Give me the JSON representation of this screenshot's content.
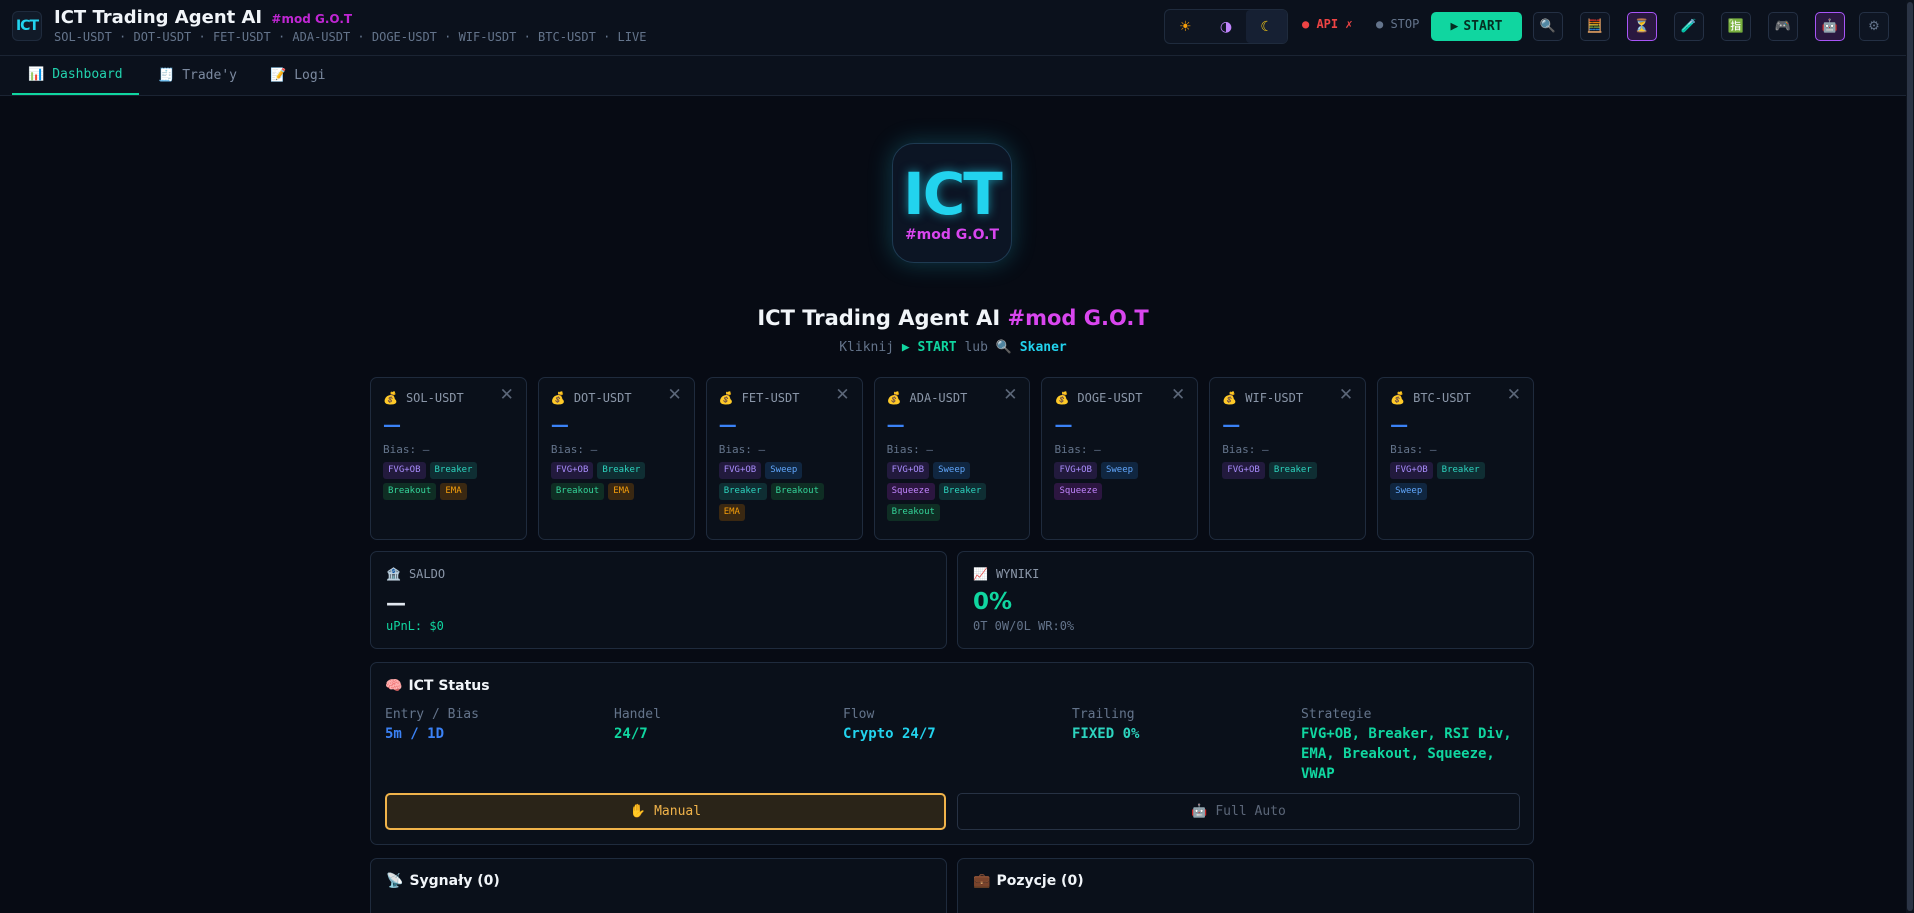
{
  "app": {
    "logo_text": "ICT",
    "title": "ICT Trading Agent AI",
    "title_tag": "#mod G.O.T",
    "ticker_line": "SOL-USDT · DOT-USDT · FET-USDT · ADA-USDT · DOGE-USDT · WIF-USDT · BTC-USDT · LIVE"
  },
  "toolbar": {
    "themes": [
      {
        "name": "light",
        "icon": "☀"
      },
      {
        "name": "contrast",
        "icon": "◑"
      },
      {
        "name": "dark",
        "icon": "☾"
      }
    ],
    "api_status": "● API ✗",
    "stop_status": "● STOP",
    "start_label": "START",
    "start_icon": "▶",
    "icons": [
      "🔍",
      "🧮",
      "⏳",
      "🧪",
      "🈯",
      "🎮",
      "🤖",
      "⚙"
    ]
  },
  "tabs": [
    {
      "icon": "📊",
      "label": "Dashboard",
      "active": true
    },
    {
      "icon": "🧾",
      "label": "Trade'y",
      "active": false
    },
    {
      "icon": "📝",
      "label": "Logi",
      "active": false
    }
  ],
  "hero": {
    "logo_text": "ICT",
    "logo_tag": "#mod G.O.T",
    "title": "ICT Trading Agent AI",
    "title_tag": "#mod G.O.T",
    "sub_prefix": "Kliknij",
    "sub_start": "▶ START",
    "sub_mid": "lub",
    "sub_scanner": "🔍 Skaner"
  },
  "pairs": [
    {
      "symbol": "SOL-USDT",
      "price": "—",
      "bias": "Bias: —",
      "tags": [
        "FVG+OB",
        "Breaker",
        "Breakout",
        "EMA"
      ]
    },
    {
      "symbol": "DOT-USDT",
      "price": "—",
      "bias": "Bias: —",
      "tags": [
        "FVG+OB",
        "Breaker",
        "Breakout",
        "EMA"
      ]
    },
    {
      "symbol": "FET-USDT",
      "price": "—",
      "bias": "Bias: —",
      "tags": [
        "FVG+OB",
        "Sweep",
        "Breaker",
        "Breakout",
        "EMA"
      ]
    },
    {
      "symbol": "ADA-USDT",
      "price": "—",
      "bias": "Bias: —",
      "tags": [
        "FVG+OB",
        "Sweep",
        "Squeeze",
        "Breaker",
        "Breakout"
      ]
    },
    {
      "symbol": "DOGE-USDT",
      "price": "—",
      "bias": "Bias: —",
      "tags": [
        "FVG+OB",
        "Sweep",
        "Squeeze"
      ]
    },
    {
      "symbol": "WIF-USDT",
      "price": "—",
      "bias": "Bias: —",
      "tags": [
        "FVG+OB",
        "Breaker"
      ]
    },
    {
      "symbol": "BTC-USDT",
      "price": "—",
      "bias": "Bias: —",
      "tags": [
        "FVG+OB",
        "Breaker",
        "Sweep"
      ]
    }
  ],
  "pair_icon": "💰",
  "close_icon": "✕",
  "balance": {
    "icon": "🏦",
    "label": "SALDO",
    "value": "—",
    "upnl": "uPnL: $0"
  },
  "results": {
    "icon": "📈",
    "label": "WYNIKI",
    "value": "0%",
    "stats": "0T 0W/0L WR:0%"
  },
  "ict_status": {
    "icon": "🧠",
    "title": "ICT Status",
    "items": [
      {
        "label": "Entry / Bias",
        "value": "5m / 1D",
        "color": "blue"
      },
      {
        "label": "Handel",
        "value": "24/7",
        "color": "green"
      },
      {
        "label": "Flow",
        "value": "Crypto 24/7",
        "color": "cyan"
      },
      {
        "label": "Trailing",
        "value": "FIXED 0%",
        "color": "teal"
      },
      {
        "label": "Strategie",
        "value": "FVG+OB, Breaker, RSI Div, EMA, Breakout, Squeeze, VWAP",
        "color": "green"
      }
    ],
    "manual_icon": "✋",
    "manual_label": "Manual",
    "auto_icon": "🤖",
    "auto_label": "Full Auto"
  },
  "signals": {
    "icon": "📡",
    "title": "Sygnały (0)"
  },
  "positions": {
    "icon": "💼",
    "title": "Pozycje (0)"
  },
  "colors": {
    "accent": "#10d6a0",
    "cyan": "#22d3ee",
    "magenta": "#d946ef",
    "warning": "#f0b34a",
    "danger": "#ef4444",
    "background": "#070b14"
  }
}
